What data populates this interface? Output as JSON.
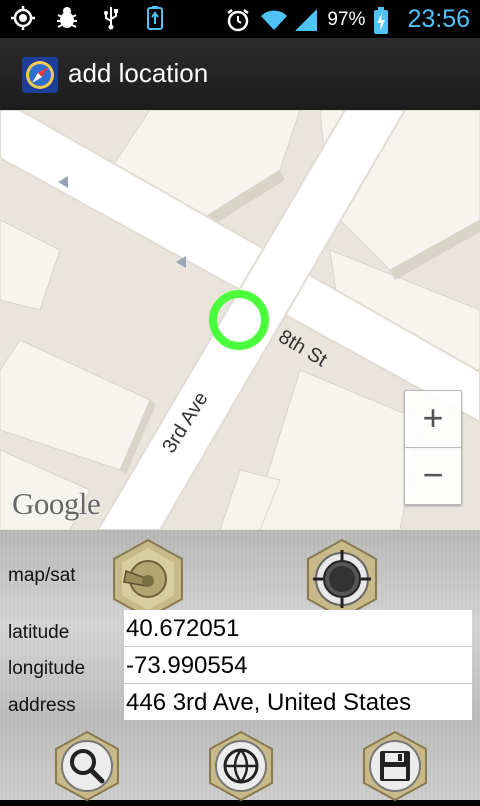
{
  "status_bar": {
    "battery_percent": "97%",
    "time": "23:56",
    "icons_left": [
      "gps-icon",
      "debug-bug-icon",
      "usb-icon",
      "battery-settings-icon"
    ],
    "icons_right": [
      "alarm-clock-icon",
      "wifi-icon",
      "signal-icon",
      "battery-charging-icon"
    ]
  },
  "action_bar": {
    "title": "add location",
    "app_icon": "compass-app-icon"
  },
  "map": {
    "street_1": "8th St",
    "street_2": "3rd Ave",
    "zoom_in_label": "+",
    "zoom_out_label": "−",
    "attribution": "Google",
    "marker_color": "#4cff3c"
  },
  "panel": {
    "map_sat_label": "map/sat",
    "latitude_label": "latitude",
    "longitude_label": "longitude",
    "address_label": "address",
    "latitude_value": "40.672051",
    "longitude_value": "-73.990554",
    "address_value": "446 3rd Ave, United States",
    "buttons": [
      "map-sat-toggle-switch",
      "gps-locate-button",
      "search-button",
      "globe-button",
      "save-button"
    ]
  },
  "colors": {
    "time_accent": "#4fc3f7",
    "map_background": "#e9e5dc",
    "road": "#ffffff",
    "building": "#f7f5f0"
  }
}
